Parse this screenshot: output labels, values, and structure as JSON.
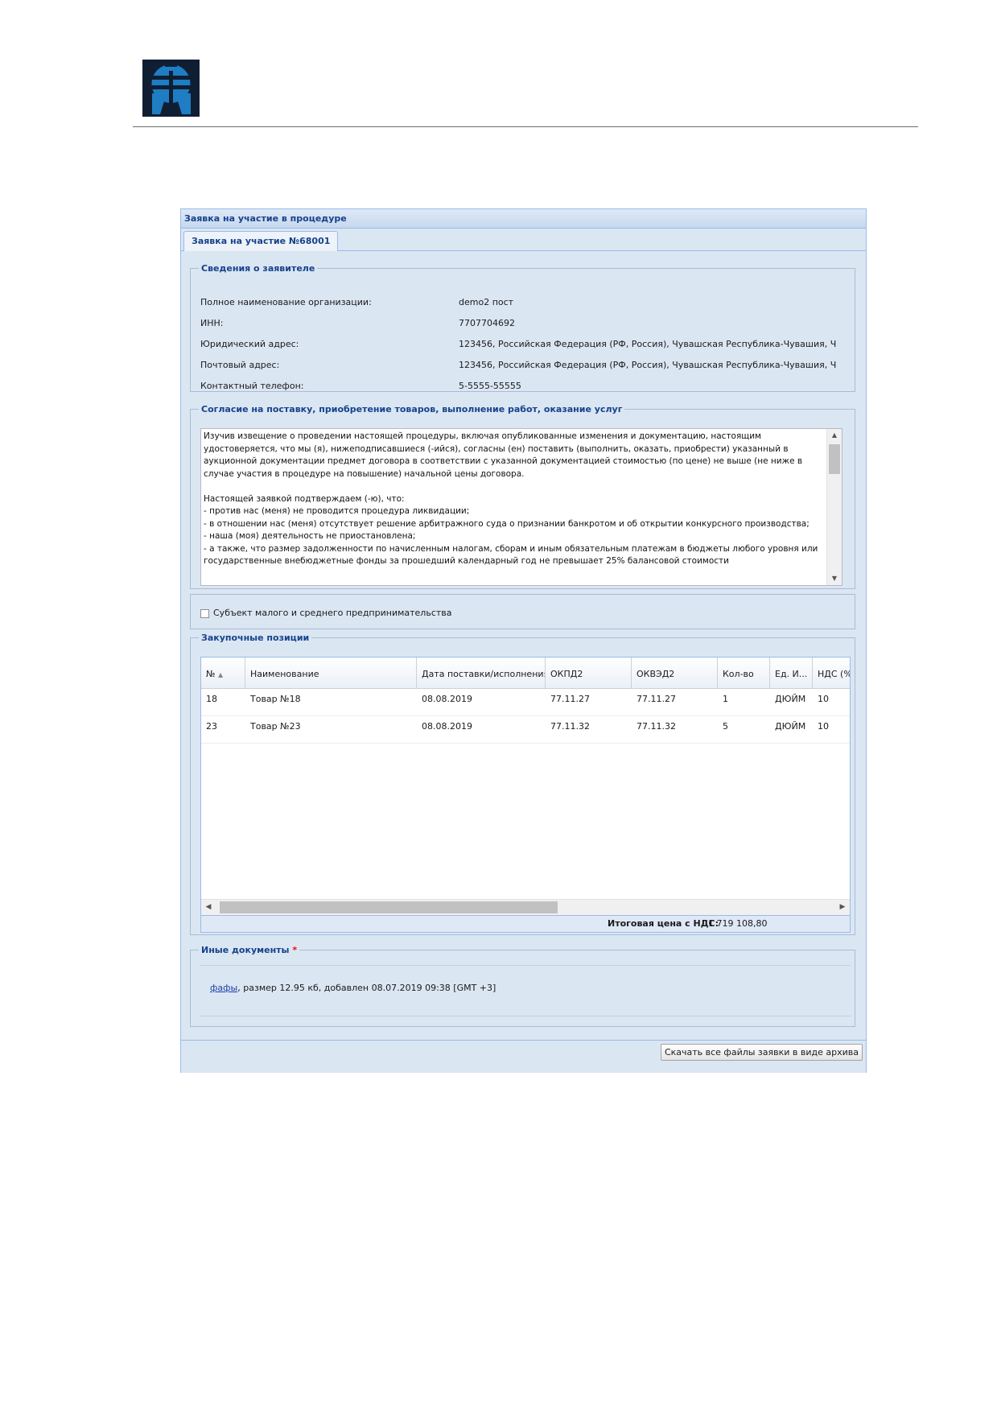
{
  "window": {
    "title": "Заявка на участие в процедуре"
  },
  "tab": {
    "label": "Заявка на участие №68001"
  },
  "applicant": {
    "legend": "Сведения о заявителе",
    "fields": [
      {
        "label": "Полное наименование организации:",
        "value": "demo2 пост"
      },
      {
        "label": "ИНН:",
        "value": "7707704692"
      },
      {
        "label": "Юридический адрес:",
        "value": "123456, Российская Федерация (РФ, Россия), Чувашская Республика-Чувашия, Ч"
      },
      {
        "label": "Почтовый адрес:",
        "value": "123456, Российская Федерация (РФ, Россия), Чувашская Республика-Чувашия, Ч"
      },
      {
        "label": "Контактный телефон:",
        "value": "5-5555-55555"
      }
    ]
  },
  "consent": {
    "legend": "Согласие на поставку, приобретение товаров, выполнение работ, оказание услуг",
    "paragraph1": "Изучив извещение о проведении настоящей процедуры, включая опубликованные изменения и документацию, настоящим удостоверяется, что мы (я), нижеподписавшиеся (-ийся), согласны (ен) поставить (выполнить, оказать, приобрести) указанный в аукционной документации предмет договора в соответствии с указанной документацией стоимостью (по цене) не выше (не ниже в случае участия в процедуре на повышение) начальной цены договора.",
    "paragraph2": "Настоящей заявкой подтверждаем (-ю), что:",
    "line1": " - против нас (меня) не проводится процедура ликвидации;",
    "line2": " - в отношении нас (меня) отсутствует решение арбитражного суда о признании банкротом и об открытии конкурсного производства;",
    "line3": " - наша (моя) деятельность не приостановлена;",
    "line4": " - а также, что размер задолженности по начисленным налогам, сборам и иным обязательным платежам в бюджеты любого уровня или государственные внебюджетные фонды за прошедший календарный год не превышает 25% балансовой стоимости"
  },
  "sme": {
    "label": "Субъект малого и среднего предпринимательства",
    "checked": false
  },
  "items": {
    "legend": "Закупочные позиции",
    "columns": [
      "№",
      "Наименование",
      "Дата поставки/исполнения",
      "ОКПД2",
      "ОКВЭД2",
      "Кол-во",
      "Ед. И...",
      "НДС (%"
    ],
    "sort_indicator": "▲",
    "rows": [
      {
        "num": "18",
        "name": "Товар №18",
        "date": "08.08.2019",
        "okpd2": "77.11.27",
        "okved2": "77.11.27",
        "qty": "1",
        "unit": "ДЮЙМ",
        "vat": "10"
      },
      {
        "num": "23",
        "name": "Товар №23",
        "date": "08.08.2019",
        "okpd2": "77.11.32",
        "okved2": "77.11.32",
        "qty": "5",
        "unit": "ДЮЙМ",
        "vat": "10"
      }
    ],
    "total_label": "Итоговая цена с НДС:",
    "total_value": "1 719 108,80"
  },
  "docs": {
    "legend": "Иные документы",
    "required_mark": "*",
    "file_link": "фафы",
    "file_info": ", размер 12.95 кб, добавлен 08.07.2019 09:38 [GMT +3]"
  },
  "footer": {
    "download_button": "Скачать все файлы заявки в виде архива"
  },
  "colors": {
    "header_text": "#15428b",
    "panel_bg": "#dbe6f3",
    "border": "#99bbe8",
    "link": "#1d3fa6",
    "required": "#ff0000"
  }
}
